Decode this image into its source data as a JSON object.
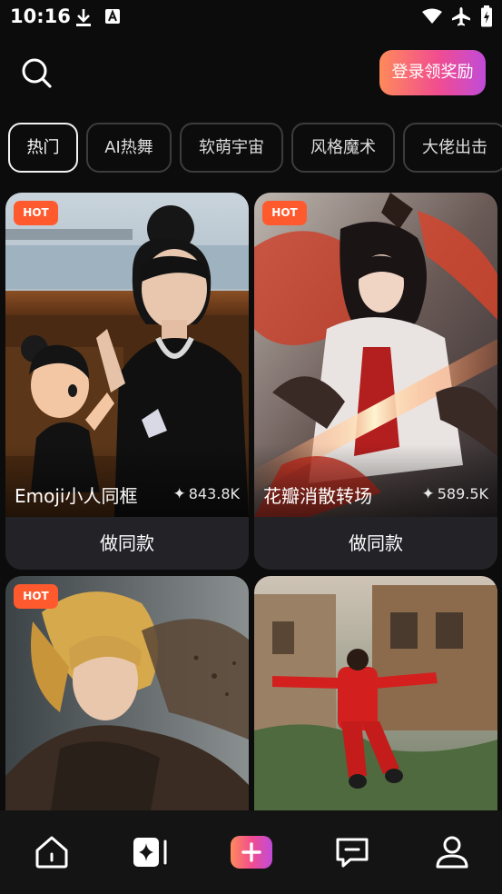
{
  "status_bar": {
    "time": "10:16"
  },
  "header": {
    "login_button": "登录领奖励"
  },
  "categories": [
    {
      "label": "热门",
      "active": true
    },
    {
      "label": "AI热舞",
      "active": false
    },
    {
      "label": "软萌宇宙",
      "active": false
    },
    {
      "label": "风格魔术",
      "active": false
    },
    {
      "label": "大佬出击",
      "active": false
    }
  ],
  "cards": [
    {
      "badge": "HOT",
      "title": "Emoji小人同框",
      "count": "843.8K",
      "button": "做同款"
    },
    {
      "badge": "HOT",
      "title": "花瓣消散转场",
      "count": "589.5K",
      "button": "做同款"
    },
    {
      "badge": "HOT"
    },
    {}
  ],
  "nav": [
    "home-icon",
    "ai-create-icon",
    "plus-icon",
    "message-icon",
    "profile-icon"
  ],
  "colors": {
    "accent_start": "#ff8a5b",
    "accent_end": "#c04bd9",
    "hot_badge": "#ff5a2e",
    "background": "#0c0c0c"
  }
}
